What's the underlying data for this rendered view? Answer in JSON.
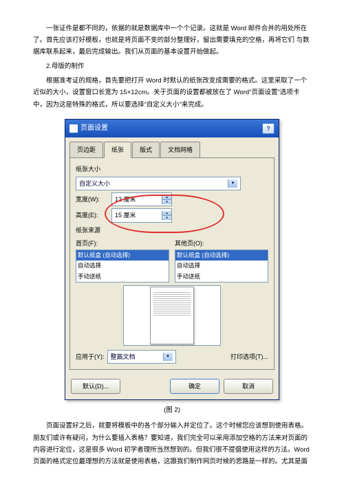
{
  "para1": "一张证件是都不同的，依据的就是数据库中一个个记录。这就是 Word 邮件合并的用处所在了。首先应该打好模板，也就是将页面不变的部分整理好，留出需要填充的空格，再将它们 与数据库联系起来，最后完成输出。我们从页面的基本设置开始做起。",
  "subhead": "2.母版的制作",
  "para2": "根据准考证的规格，首先要把打开 Word 时默认的纸张改变成需要的格式。这里采取了一个近似的大小，设置窗口长宽为 15×12cm。关于页面的设置都被放在了 Word\"页面设置\"选项卡中，因为这是特殊的格式，所以要选择\"自定义大小\"来完成。",
  "caption": "(图 2)",
  "para3": "页面设置好之后，就要将模板中的各个部分输入并定位了。这个时候您应该想到使用表格。朋友们或许有疑问，为什么要插入表格？要知道，我们完全可以采用添加空格的方法来对页面的内容进行定位，这是很多 Word 初学者理所当然想到的。但我们很不提倡使用这样的方法。Word 页面的格式定位最理想的方法就是使用表格，这跟我们制作网页时候的思路是一样的。尤其是面",
  "dialog": {
    "title": "页面设置",
    "help": "?",
    "tabs": [
      "页边距",
      "纸张",
      "版式",
      "文档网格"
    ],
    "paper_size_label": "纸张大小",
    "size_dd": "自定义大小",
    "width_label": "宽度(W):",
    "width_val": "12 厘米",
    "height_label": "高度(E):",
    "height_val": "15 厘米",
    "source_label": "纸张来源",
    "first_page": "首页(F):",
    "other_pages": "其他页(O):",
    "list": [
      "默认纸盒 (自动选择)",
      "自动选择",
      "手动送纸"
    ],
    "apply_label": "应用于(Y):",
    "apply_val": "整篇文档",
    "print_opt": "打印选项(T)...",
    "default_btn": "默认(D)...",
    "ok": "确定",
    "cancel": "取消"
  }
}
